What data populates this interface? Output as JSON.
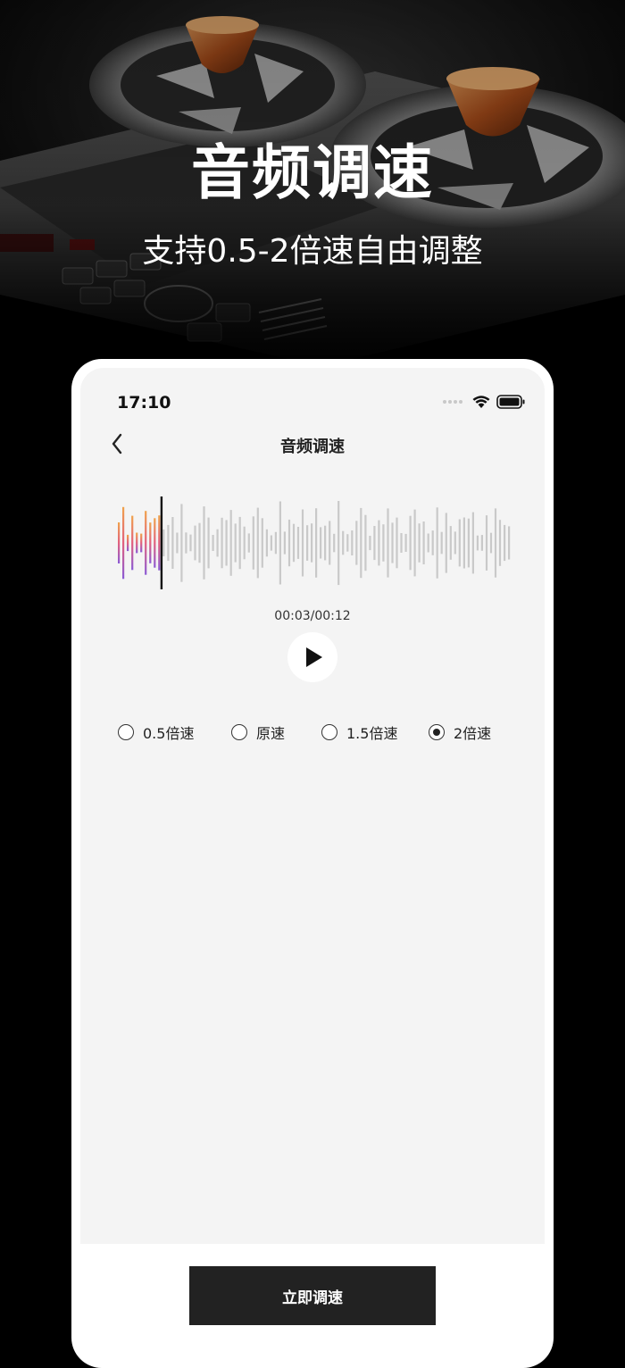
{
  "hero": {
    "title": "音频调速",
    "subtitle": "支持0.5-2倍速自由调整"
  },
  "status_bar": {
    "time": "17:10",
    "icons": [
      "signal-dots-icon",
      "wifi-icon",
      "battery-icon"
    ]
  },
  "nav": {
    "back_icon": "chevron-left-icon",
    "title": "音频调速"
  },
  "player": {
    "time_readout": "00:03/00:12",
    "progress": 0.25,
    "play_icon": "play-icon",
    "played_gradient": [
      "#f0a24a",
      "#e2607e",
      "#8a5ad6"
    ],
    "unplayed_color": "#c9c9c9",
    "cursor_color": "#111111"
  },
  "speed_options": [
    {
      "label": "0.5倍速",
      "checked": false
    },
    {
      "label": "原速",
      "checked": false
    },
    {
      "label": "1.5倍速",
      "checked": false
    },
    {
      "label": "2倍速",
      "checked": true
    }
  ],
  "action": {
    "label": "立即调速"
  }
}
